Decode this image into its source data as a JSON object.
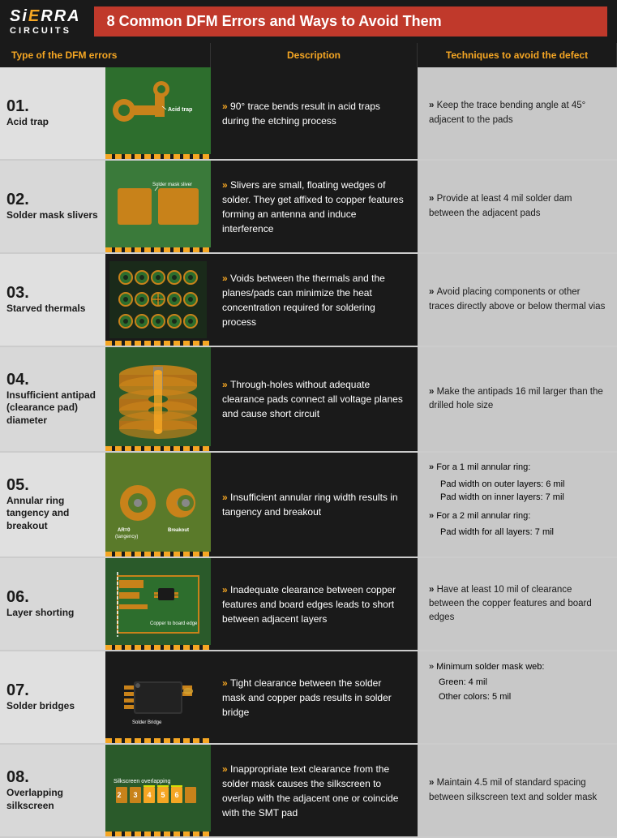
{
  "header": {
    "logo_sierra": "SiERRA",
    "logo_circuits": "CIRCUITS",
    "title": "8 Common DFM Errors and Ways to Avoid Them"
  },
  "col_headers": {
    "type": "Type of the DFM errors",
    "description": "Description",
    "technique": "Techniques to avoid the defect"
  },
  "rows": [
    {
      "num": "01.",
      "name": "Acid trap",
      "description": "90° trace bends result in acid traps during the etching process",
      "technique": "Keep the trace bending angle at 45° adjacent to the pads",
      "image_label": "Acid trap"
    },
    {
      "num": "02.",
      "name": "Solder mask slivers",
      "description": "Slivers are small, floating wedges of solder. They get affixed to copper features forming an antenna and induce interference",
      "technique": "Provide at least 4 mil solder dam between the adjacent pads",
      "image_label": "Solder mask sliver"
    },
    {
      "num": "03.",
      "name": "Starved thermals",
      "description": "Voids between the thermals and the planes/pads can minimize the heat concentration required for soldering process",
      "technique": "Avoid placing components or other traces directly above or below thermal vias",
      "image_label": ""
    },
    {
      "num": "04.",
      "name": "Insufficient antipad (clearance pad) diameter",
      "description": "Through-holes without adequate clearance pads connect all voltage planes and cause short circuit",
      "technique": "Make the antipads 16 mil larger than the drilled hole size",
      "image_label": ""
    },
    {
      "num": "05.",
      "name": "Annular ring tangency and breakout",
      "description": "Insufficient annular ring width results in tangency and breakout",
      "technique_multi": [
        "For a 1 mil annular ring:",
        "Pad width on outer layers: 6 mil",
        "Pad width on inner layers: 7 mil",
        "For a 2 mil annular ring:",
        "Pad width for all layers: 7 mil"
      ],
      "image_label": "AR=0 (tangency) / Breakout"
    },
    {
      "num": "06.",
      "name": "Layer shorting",
      "description": "Inadequate clearance between copper features and board edges leads to short between adjacent layers",
      "technique": "Have at least 10 mil of clearance between the copper features and board edges",
      "image_label": ""
    },
    {
      "num": "07.",
      "name": "Solder bridges",
      "description": "Tight clearance between the solder mask and copper pads results in solder bridge",
      "technique": "Minimum solder mask web:\nGreen: 4 mil\nOther colors: 5 mil",
      "image_label": "Solder Bridge"
    },
    {
      "num": "08.",
      "name": "Overlapping silkscreen",
      "description": "Inappropriate text clearance from the solder mask causes the silkscreen to overlap with the adjacent one or coincide with the SMT pad",
      "technique": "Maintain 4.5 mil of standard spacing between silkscreen text and solder mask",
      "image_label": ""
    }
  ]
}
